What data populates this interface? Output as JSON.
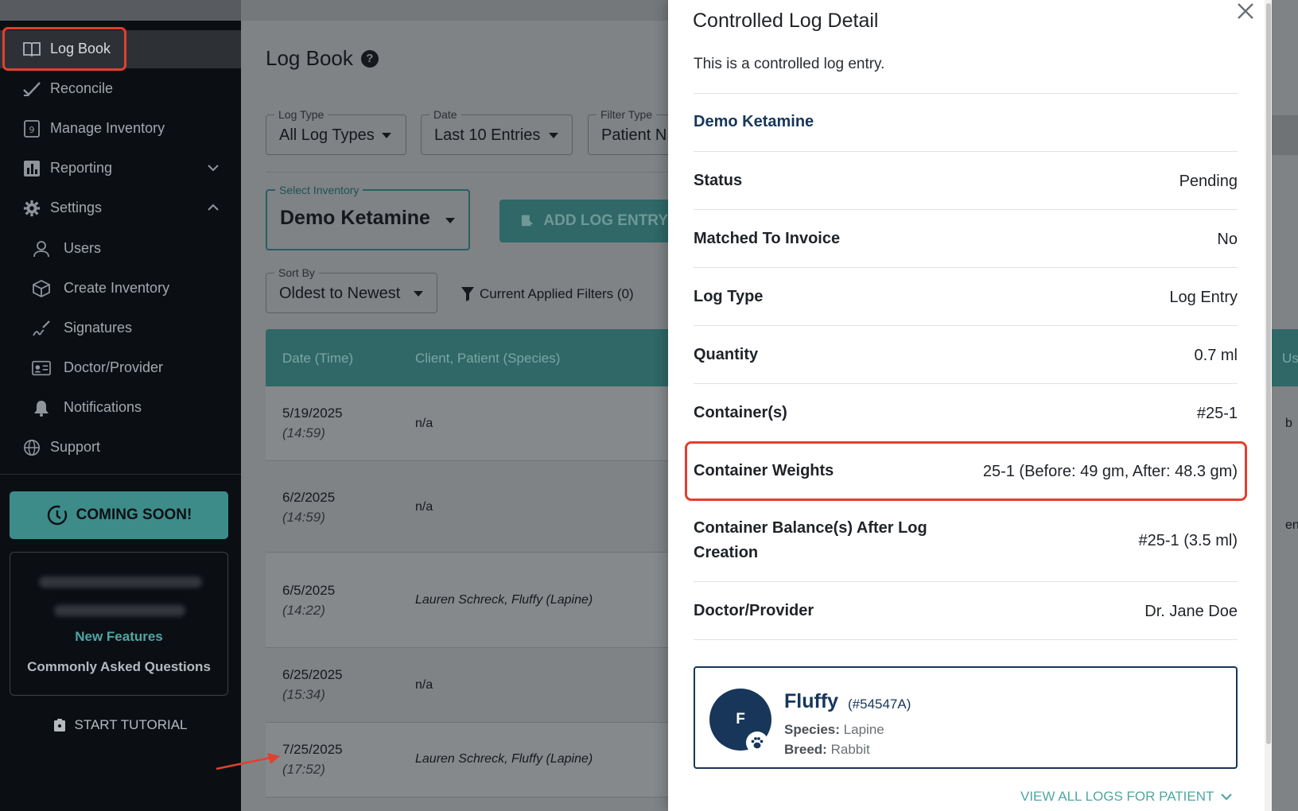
{
  "sidebar": {
    "items": [
      {
        "label": "Log Book",
        "icon": "book-icon"
      },
      {
        "label": "Reconcile",
        "icon": "check-icon"
      },
      {
        "label": "Manage Inventory",
        "icon": "inventory-icon"
      },
      {
        "label": "Reporting",
        "icon": "chart-icon"
      },
      {
        "label": "Settings",
        "icon": "gear-icon"
      }
    ],
    "sub_items": [
      {
        "label": "Users",
        "icon": "user-icon"
      },
      {
        "label": "Create Inventory",
        "icon": "cube-icon"
      },
      {
        "label": "Signatures",
        "icon": "signature-icon"
      },
      {
        "label": "Doctor/Provider",
        "icon": "id-card-icon"
      },
      {
        "label": "Notifications",
        "icon": "bell-icon"
      }
    ],
    "support_label": "Support",
    "coming_soon": "COMING SOON!",
    "new_features": "New Features",
    "common_questions": "Commonly Asked Questions",
    "start_tutorial": "START TUTORIAL"
  },
  "main": {
    "title": "Log Book",
    "filters": {
      "log_type": {
        "legend": "Log Type",
        "value": "All Log Types"
      },
      "date": {
        "legend": "Date",
        "value": "Last 10 Entries"
      },
      "filter_type": {
        "legend": "Filter Type",
        "value": "Patient N"
      }
    },
    "select_inventory": {
      "legend": "Select Inventory",
      "value": "Demo Ketamine"
    },
    "add_log_entry": "ADD LOG ENTRY",
    "sort_by": {
      "legend": "Sort By",
      "value": "Oldest to Newest"
    },
    "applied_filters": "Current Applied Filters (0)",
    "table": {
      "headers": [
        "Date (Time)",
        "Client, Patient (Species)"
      ],
      "rows": [
        {
          "date": "5/19/2025",
          "time": "(14:59)",
          "client": "n/a"
        },
        {
          "date": "6/2/2025",
          "time": "(14:59)",
          "client": "n/a"
        },
        {
          "date": "6/5/2025",
          "time": "(14:22)",
          "client": "Lauren Schreck, Fluffy (Lapine)"
        },
        {
          "date": "6/25/2025",
          "time": "(15:34)",
          "client": "n/a"
        },
        {
          "date": "7/25/2025",
          "time": "(17:52)",
          "client": "Lauren Schreck, Fluffy (Lapine)"
        }
      ]
    },
    "edge_header": "Us",
    "edge_cells": [
      "b",
      "ent"
    ]
  },
  "drawer": {
    "title": "Controlled Log Detail",
    "subtitle": "This is a controlled log entry.",
    "drug": "Demo Ketamine",
    "details": [
      {
        "label": "Status",
        "value": "Pending"
      },
      {
        "label": "Matched To Invoice",
        "value": "No"
      },
      {
        "label": "Log Type",
        "value": "Log Entry"
      },
      {
        "label": "Quantity",
        "value": "0.7 ml"
      },
      {
        "label": "Container(s)",
        "value": "#25-1"
      },
      {
        "label": "Container Weights",
        "value": "25-1 (Before: 49 gm, After: 48.3 gm)"
      },
      {
        "label_line1": "Container Balance(s) After Log",
        "label_line2": "Creation",
        "value": "#25-1 (3.5 ml)"
      },
      {
        "label": "Doctor/Provider",
        "value": "Dr. Jane Doe"
      }
    ],
    "patient": {
      "initial": "F",
      "name": "Fluffy",
      "id": "(#54547A)",
      "species_label": "Species:",
      "species": "Lapine",
      "breed_label": "Breed:",
      "breed": "Rabbit"
    },
    "view_all": "VIEW ALL LOGS FOR PATIENT"
  },
  "colors": {
    "accent_teal": "#3d8c8a",
    "navy": "#17365a",
    "annotation_red": "#e0412e"
  }
}
